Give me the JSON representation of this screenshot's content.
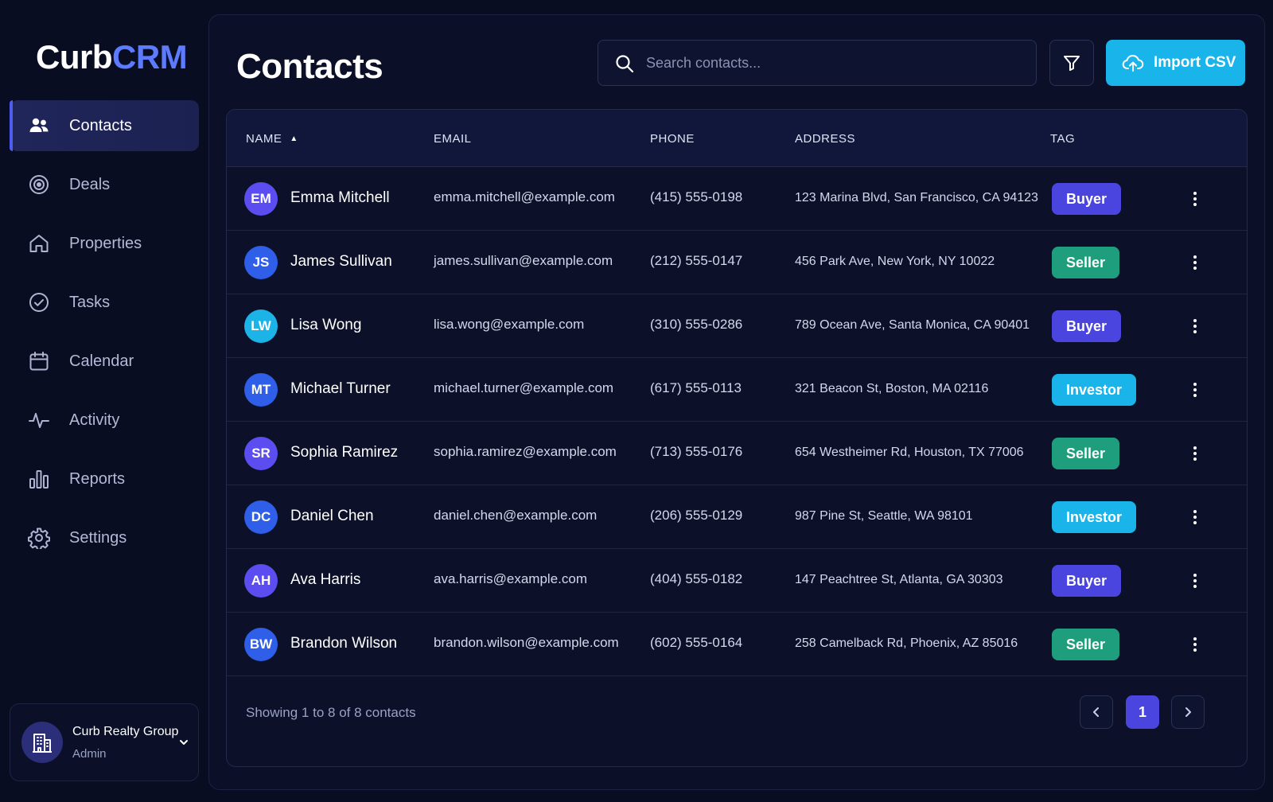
{
  "brand": {
    "part1": "Curb",
    "part2": "CRM"
  },
  "sidebar": {
    "items": [
      {
        "label": "Contacts",
        "icon": "users-icon",
        "active": true
      },
      {
        "label": "Deals",
        "icon": "target-icon"
      },
      {
        "label": "Properties",
        "icon": "home-icon"
      },
      {
        "label": "Tasks",
        "icon": "check-circle-icon"
      },
      {
        "label": "Calendar",
        "icon": "calendar-icon"
      },
      {
        "label": "Activity",
        "icon": "activity-icon"
      },
      {
        "label": "Reports",
        "icon": "bar-chart-icon"
      },
      {
        "label": "Settings",
        "icon": "gear-icon"
      }
    ],
    "org": {
      "name": "Curb Realty Group",
      "role": "Admin",
      "icon": "building-icon"
    }
  },
  "header": {
    "title": "Contacts",
    "search_placeholder": "Search contacts...",
    "filter_icon": "filter-icon",
    "import_label": "Import CSV",
    "import_icon": "cloud-upload-icon"
  },
  "table": {
    "columns": [
      "NAME",
      "EMAIL",
      "PHONE",
      "ADDRESS",
      "TAG"
    ],
    "sort": {
      "column": "NAME",
      "direction": "ascending"
    },
    "rows": [
      {
        "initials": "EM",
        "name": "Emma Mitchell",
        "email": "emma.mitchell@example.com",
        "phone": "(415) 555-0198",
        "address": "123 Marina Blvd, San Francisco, CA 94123",
        "tag": "Buyer",
        "avatar_color": "#5b4df0"
      },
      {
        "initials": "JS",
        "name": "James Sullivan",
        "email": "james.sullivan@example.com",
        "phone": "(212) 555-0147",
        "address": "456 Park Ave, New York, NY 10022",
        "tag": "Seller",
        "avatar_color": "#2f5ee8"
      },
      {
        "initials": "LW",
        "name": "Lisa Wong",
        "email": "lisa.wong@example.com",
        "phone": "(310) 555-0286",
        "address": "789 Ocean Ave, Santa Monica, CA 90401",
        "tag": "Buyer",
        "avatar_color": "#1cb3e6"
      },
      {
        "initials": "MT",
        "name": "Michael Turner",
        "email": "michael.turner@example.com",
        "phone": "(617) 555-0113",
        "address": "321 Beacon St, Boston, MA 02116",
        "tag": "Investor",
        "avatar_color": "#2f5ee8"
      },
      {
        "initials": "SR",
        "name": "Sophia Ramirez",
        "email": "sophia.ramirez@example.com",
        "phone": "(713) 555-0176",
        "address": "654 Westheimer Rd, Houston, TX 77006",
        "tag": "Seller",
        "avatar_color": "#5b4df0"
      },
      {
        "initials": "DC",
        "name": "Daniel Chen",
        "email": "daniel.chen@example.com",
        "phone": "(206) 555-0129",
        "address": "987 Pine St, Seattle, WA 98101",
        "tag": "Investor",
        "avatar_color": "#2f5ee8"
      },
      {
        "initials": "AH",
        "name": "Ava Harris",
        "email": "ava.harris@example.com",
        "phone": "(404) 555-0182",
        "address": "147 Peachtree St, Atlanta, GA 30303",
        "tag": "Buyer",
        "avatar_color": "#5b4df0"
      },
      {
        "initials": "BW",
        "name": "Brandon Wilson",
        "email": "brandon.wilson@example.com",
        "phone": "(602) 555-0164",
        "address": "258 Camelback Rd, Phoenix, AZ 85016",
        "tag": "Seller",
        "avatar_color": "#2f5ee8"
      }
    ],
    "tag_colors": {
      "Buyer": "#4b45e0",
      "Seller": "#1e9e7c",
      "Investor": "#19b4ea"
    }
  },
  "footer": {
    "showing_text": "Showing 1 to 8 of 8 contacts",
    "current_page": "1",
    "prev_icon": "chevron-left-icon",
    "next_icon": "chevron-right-icon"
  }
}
